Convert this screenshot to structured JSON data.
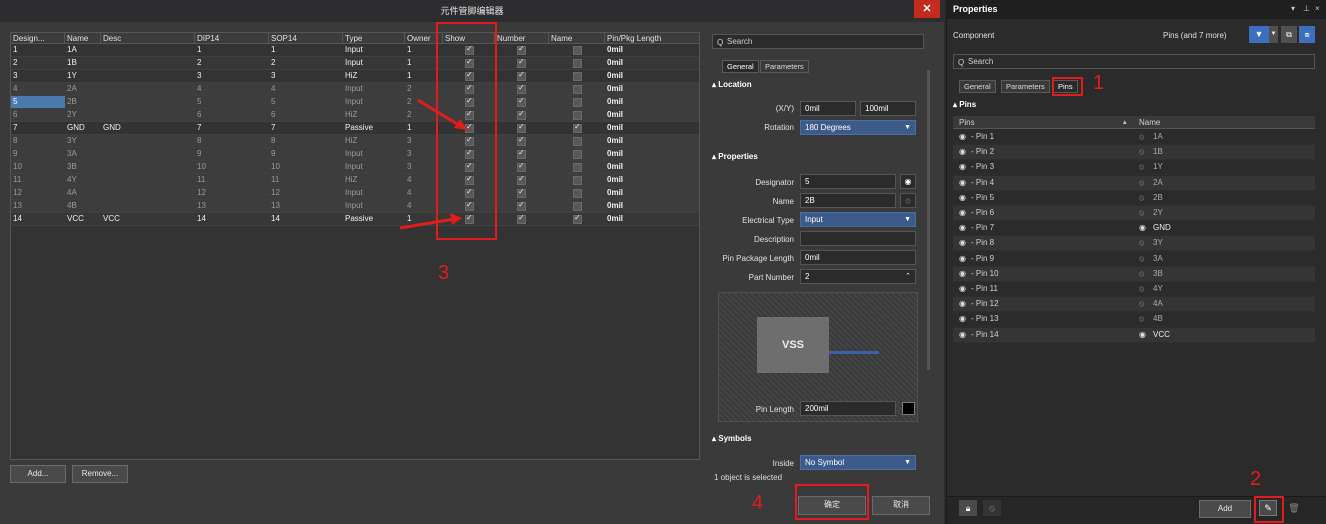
{
  "editor": {
    "title": "元件管脚编辑器",
    "close": "✕",
    "columns": [
      "Design...",
      "Name",
      "Desc",
      "DIP14",
      "SOP14",
      "Type",
      "Owner",
      "Show",
      "Number",
      "Name",
      "Pin/Pkg Length"
    ],
    "rows": [
      {
        "des": "1",
        "name": "1A",
        "desc": "",
        "dip": "1",
        "sop": "1",
        "type": "Input",
        "owner": "1",
        "show": true,
        "number": true,
        "nm": false,
        "len": "0mil"
      },
      {
        "des": "2",
        "name": "1B",
        "desc": "",
        "dip": "2",
        "sop": "2",
        "type": "Input",
        "owner": "1",
        "show": true,
        "number": true,
        "nm": false,
        "len": "0mil"
      },
      {
        "des": "3",
        "name": "1Y",
        "desc": "",
        "dip": "3",
        "sop": "3",
        "type": "HiZ",
        "owner": "1",
        "show": true,
        "number": true,
        "nm": false,
        "len": "0mil"
      },
      {
        "des": "4",
        "name": "2A",
        "desc": "",
        "dip": "4",
        "sop": "4",
        "type": "Input",
        "owner": "2",
        "show": true,
        "number": true,
        "nm": false,
        "len": "0mil"
      },
      {
        "des": "5",
        "name": "2B",
        "desc": "",
        "dip": "5",
        "sop": "5",
        "type": "Input",
        "owner": "2",
        "show": true,
        "number": true,
        "nm": false,
        "len": "0mil"
      },
      {
        "des": "6",
        "name": "2Y",
        "desc": "",
        "dip": "6",
        "sop": "6",
        "type": "HiZ",
        "owner": "2",
        "show": true,
        "number": true,
        "nm": false,
        "len": "0mil"
      },
      {
        "des": "7",
        "name": "GND",
        "desc": "GND",
        "dip": "7",
        "sop": "7",
        "type": "Passive",
        "owner": "1",
        "show": true,
        "number": true,
        "nm": true,
        "len": "0mil"
      },
      {
        "des": "8",
        "name": "3Y",
        "desc": "",
        "dip": "8",
        "sop": "8",
        "type": "HiZ",
        "owner": "3",
        "show": true,
        "number": true,
        "nm": false,
        "len": "0mil"
      },
      {
        "des": "9",
        "name": "3A",
        "desc": "",
        "dip": "9",
        "sop": "9",
        "type": "Input",
        "owner": "3",
        "show": true,
        "number": true,
        "nm": false,
        "len": "0mil"
      },
      {
        "des": "10",
        "name": "3B",
        "desc": "",
        "dip": "10",
        "sop": "10",
        "type": "Input",
        "owner": "3",
        "show": true,
        "number": true,
        "nm": false,
        "len": "0mil"
      },
      {
        "des": "11",
        "name": "4Y",
        "desc": "",
        "dip": "11",
        "sop": "11",
        "type": "HiZ",
        "owner": "4",
        "show": true,
        "number": true,
        "nm": false,
        "len": "0mil"
      },
      {
        "des": "12",
        "name": "4A",
        "desc": "",
        "dip": "12",
        "sop": "12",
        "type": "Input",
        "owner": "4",
        "show": true,
        "number": true,
        "nm": false,
        "len": "0mil"
      },
      {
        "des": "13",
        "name": "4B",
        "desc": "",
        "dip": "13",
        "sop": "13",
        "type": "Input",
        "owner": "4",
        "show": true,
        "number": true,
        "nm": false,
        "len": "0mil"
      },
      {
        "des": "14",
        "name": "VCC",
        "desc": "VCC",
        "dip": "14",
        "sop": "14",
        "type": "Passive",
        "owner": "1",
        "show": true,
        "number": true,
        "nm": true,
        "len": "0mil"
      }
    ],
    "add_label": "Add...",
    "remove_label": "Remove...",
    "ok_label": "确定",
    "cancel_label": "取消"
  },
  "pin_panel": {
    "search_placeholder": "Search",
    "tabs": [
      "General",
      "Parameters"
    ],
    "location_head": "Location",
    "xy_label": "(X/Y)",
    "x_value": "0mil",
    "y_value": "100mil",
    "rotation_label": "Rotation",
    "rotation_value": "180 Degrees",
    "properties_head": "Properties",
    "designator_label": "Designator",
    "designator_value": "5",
    "name_label": "Name",
    "name_value": "2B",
    "etype_label": "Electrical Type",
    "etype_value": "Input",
    "desc_label": "Description",
    "desc_value": "",
    "ppl_label": "Pin Package Length",
    "ppl_value": "0mil",
    "part_label": "Part Number",
    "part_value": "2",
    "preview_text": "VSS",
    "pin_length_label": "Pin Length",
    "pin_length_value": "200mil",
    "symbols_head": "Symbols",
    "inside_label": "Inside",
    "inside_value": "No Symbol",
    "status": "1 object is selected"
  },
  "properties": {
    "title": "Properties",
    "component_label": "Component",
    "filter_text": "Pins (and 7 more)",
    "search_placeholder": "Search",
    "tabs": [
      "General",
      "Parameters",
      "Pins"
    ],
    "pins_head": "Pins",
    "col_pins": "Pins",
    "col_name": "Name",
    "pins": [
      {
        "pin": "- Pin 1",
        "name": "1A",
        "hidden": true
      },
      {
        "pin": "- Pin 2",
        "name": "1B",
        "hidden": true
      },
      {
        "pin": "- Pin 3",
        "name": "1Y",
        "hidden": true
      },
      {
        "pin": "- Pin 4",
        "name": "2A",
        "hidden": true
      },
      {
        "pin": "- Pin 5",
        "name": "2B",
        "hidden": true
      },
      {
        "pin": "- Pin 6",
        "name": "2Y",
        "hidden": true
      },
      {
        "pin": "- Pin 7",
        "name": "GND",
        "hidden": false
      },
      {
        "pin": "- Pin 8",
        "name": "3Y",
        "hidden": true
      },
      {
        "pin": "- Pin 9",
        "name": "3A",
        "hidden": true
      },
      {
        "pin": "- Pin 10",
        "name": "3B",
        "hidden": true
      },
      {
        "pin": "- Pin 11",
        "name": "4Y",
        "hidden": true
      },
      {
        "pin": "- Pin 12",
        "name": "4A",
        "hidden": true
      },
      {
        "pin": "- Pin 13",
        "name": "4B",
        "hidden": true
      },
      {
        "pin": "- Pin 14",
        "name": "VCC",
        "hidden": false
      }
    ],
    "add_label": "Add"
  },
  "annotations": {
    "n1": "1",
    "n2": "2",
    "n3": "3",
    "n4": "4"
  },
  "colors": {
    "annotation": "#e11c1c",
    "accent": "#3c5a8a",
    "selected": "#4a7bb0"
  }
}
